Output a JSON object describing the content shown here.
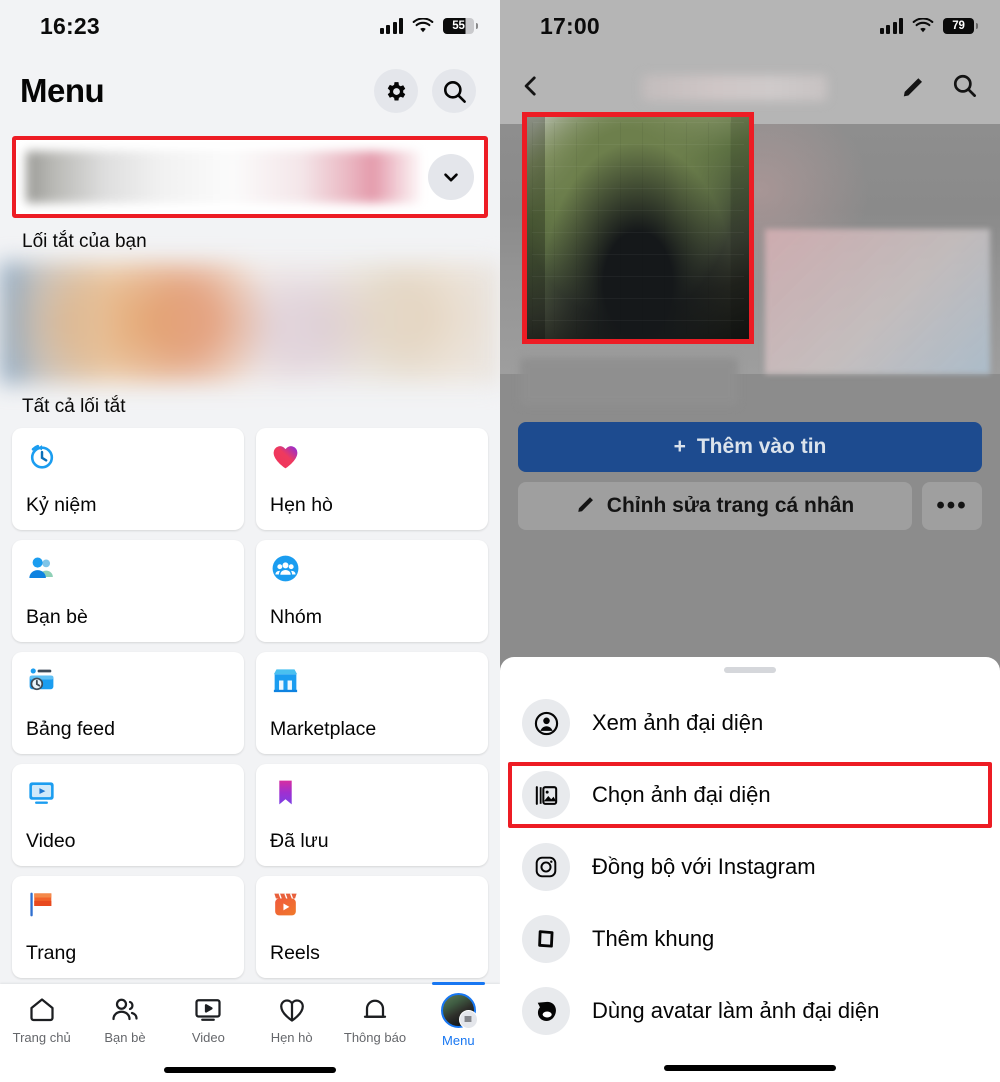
{
  "left_panel": {
    "status_bar": {
      "time": "16:23",
      "battery": "55",
      "signal_icon": "cellular-bars-icon",
      "wifi_icon": "wifi-icon",
      "battery_icon": "battery-icon"
    },
    "header": {
      "title": "Menu",
      "settings_icon": "gear-icon",
      "search_icon": "search-icon"
    },
    "profile_row": {
      "chevron_icon": "chevron-down-icon",
      "highlighted": true
    },
    "sections": {
      "your_shortcuts": "Lối tắt của bạn",
      "all_shortcuts": "Tất cả lối tắt"
    },
    "shortcuts": [
      {
        "label": "Kỷ niệm",
        "icon": "memories-clock-icon"
      },
      {
        "label": "Hẹn hò",
        "icon": "dating-heart-icon"
      },
      {
        "label": "Bạn bè",
        "icon": "friends-icon"
      },
      {
        "label": "Nhóm",
        "icon": "groups-icon"
      },
      {
        "label": "Bảng feed",
        "icon": "feeds-icon"
      },
      {
        "label": "Marketplace",
        "icon": "marketplace-icon"
      },
      {
        "label": "Video",
        "icon": "video-icon"
      },
      {
        "label": "Đã lưu",
        "icon": "saved-bookmark-icon"
      },
      {
        "label": "Trang",
        "icon": "pages-flag-icon"
      },
      {
        "label": "Reels",
        "icon": "reels-icon"
      }
    ],
    "bottom_nav": [
      {
        "label": "Trang chủ",
        "icon": "home-icon",
        "active": false
      },
      {
        "label": "Bạn bè",
        "icon": "friends-outline-icon",
        "active": false
      },
      {
        "label": "Video",
        "icon": "video-outline-icon",
        "active": false
      },
      {
        "label": "Hẹn hò",
        "icon": "dating-outline-icon",
        "active": false
      },
      {
        "label": "Thông báo",
        "icon": "bell-icon",
        "active": false
      },
      {
        "label": "Menu",
        "icon": "avatar-menu-icon",
        "active": true
      }
    ]
  },
  "right_panel": {
    "status_bar": {
      "time": "17:00",
      "battery": "79",
      "signal_icon": "cellular-bars-icon",
      "wifi_icon": "wifi-icon",
      "battery_icon": "battery-icon"
    },
    "header": {
      "back_icon": "back-chevron-icon",
      "edit_icon": "pencil-icon",
      "search_icon": "search-icon"
    },
    "profile": {
      "avatar_icon": "profile-avatar-image",
      "avatar_highlighted": true,
      "add_to_story_label": "Thêm vào tin",
      "add_to_story_plus_icon": "plus-icon",
      "edit_profile_label": "Chỉnh sửa trang cá nhân",
      "edit_profile_icon": "pencil-icon",
      "more_label": "•••",
      "more_icon": "ellipsis-icon"
    },
    "action_sheet": {
      "grabber_icon": "drag-handle-icon",
      "items": [
        {
          "label": "Xem ảnh đại diện",
          "icon": "person-circle-icon",
          "highlighted": false
        },
        {
          "label": "Chọn ảnh đại diện",
          "icon": "photo-stack-icon",
          "highlighted": true
        },
        {
          "label": "Đồng bộ với Instagram",
          "icon": "instagram-icon",
          "highlighted": false
        },
        {
          "label": "Thêm khung",
          "icon": "frame-icon",
          "highlighted": false
        },
        {
          "label": "Dùng avatar làm ảnh đại diện",
          "icon": "avatar-face-icon",
          "highlighted": false
        }
      ]
    }
  },
  "colors": {
    "highlight_red": "#ed1c24",
    "facebook_blue": "#1877f2",
    "story_button_blue": "#1d4b8f",
    "left_bg": "#f2f3f5",
    "card_bg": "#ffffff",
    "sheet_bg": "#ffffff"
  }
}
